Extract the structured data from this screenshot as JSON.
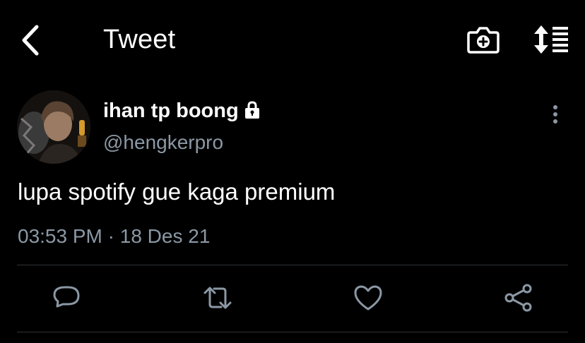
{
  "header": {
    "title": "Tweet",
    "back_icon": "chevron-left-icon",
    "camera_icon": "camera-plus-icon",
    "sort_icon": "sort-list-icon"
  },
  "tweet": {
    "display_name": "ihan tp boong",
    "protected": true,
    "handle": "@hengkerpro",
    "text": "lupa spotify gue kaga premium",
    "time": "03:53 PM",
    "separator": "·",
    "date": "18 Des 21"
  },
  "actions": [
    "reply-icon",
    "retweet-icon",
    "like-icon",
    "share-icon"
  ],
  "colors": {
    "background": "#000000",
    "text_primary": "#ffffff",
    "text_secondary": "#8b98a5",
    "divider": "#2f3336"
  }
}
